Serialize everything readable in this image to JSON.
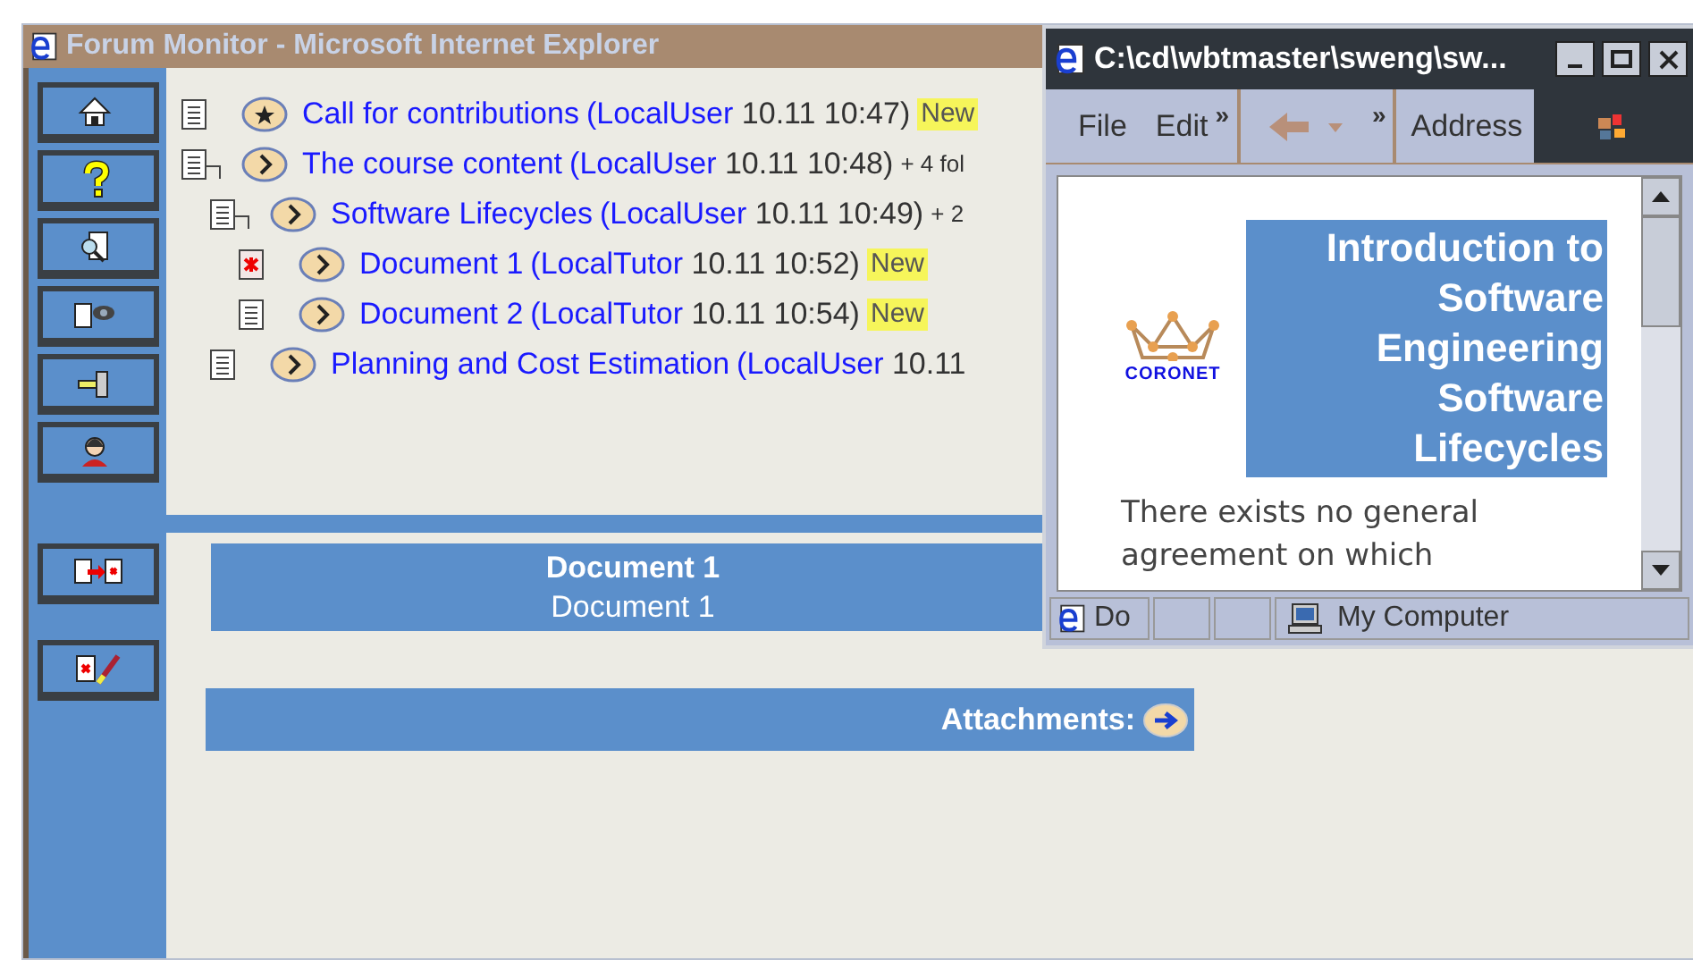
{
  "window": {
    "title": "Forum Monitor - Microsoft Internet Explorer"
  },
  "sidebar": {
    "top_buttons": [
      {
        "kind": "home"
      },
      {
        "kind": "help"
      },
      {
        "kind": "search"
      },
      {
        "kind": "view"
      },
      {
        "kind": "hammer"
      },
      {
        "kind": "person"
      }
    ],
    "bottom_buttons": [
      {
        "kind": "copy"
      },
      {
        "kind": "edit"
      }
    ]
  },
  "tree": [
    {
      "kind": "doc",
      "starred": true,
      "title": "Call for contributions",
      "author": "(LocalUser",
      "time": "10.11 10:47)",
      "badge": "New"
    },
    {
      "kind": "folder",
      "starred": false,
      "title": "The course content",
      "author": "(LocalUser",
      "time": "10.11 10:48)",
      "suffix": "+ 4 fol",
      "children": [
        {
          "kind": "folder",
          "starred": false,
          "title": "Software Lifecycles",
          "author": "(LocalUser",
          "time": "10.11 10:49)",
          "suffix": "+ 2",
          "children": [
            {
              "kind": "doc-marked",
              "starred": false,
              "title": "Document 1",
              "author": "(LocalTutor",
              "time": "10.11 10:52)",
              "badge": "New"
            },
            {
              "kind": "doc",
              "starred": false,
              "title": "Document 2",
              "author": "(LocalTutor",
              "time": "10.11 10:54)",
              "badge": "New"
            }
          ]
        },
        {
          "kind": "doc",
          "starred": false,
          "title": "Planning and Cost Estimation",
          "author": "(LocalUser",
          "time": "10.11"
        }
      ]
    }
  ],
  "document": {
    "title": "Document 1",
    "subtitle": "Document 1"
  },
  "attachments": {
    "label": "Attachments:"
  },
  "popup": {
    "title": "C:\\cd\\wbtmaster\\sweng\\sw...",
    "menu": [
      "File",
      "Edit"
    ],
    "chevrons": [
      "»",
      "»"
    ],
    "address_label": "Address",
    "logo_text": "CORONET",
    "heading_lines": [
      "Introduction to",
      "Software",
      "Engineering",
      "Software",
      "Lifecycles"
    ],
    "paragraph": "There exists no general agreement on which",
    "status": {
      "text": "Do",
      "zone": "My Computer"
    }
  }
}
